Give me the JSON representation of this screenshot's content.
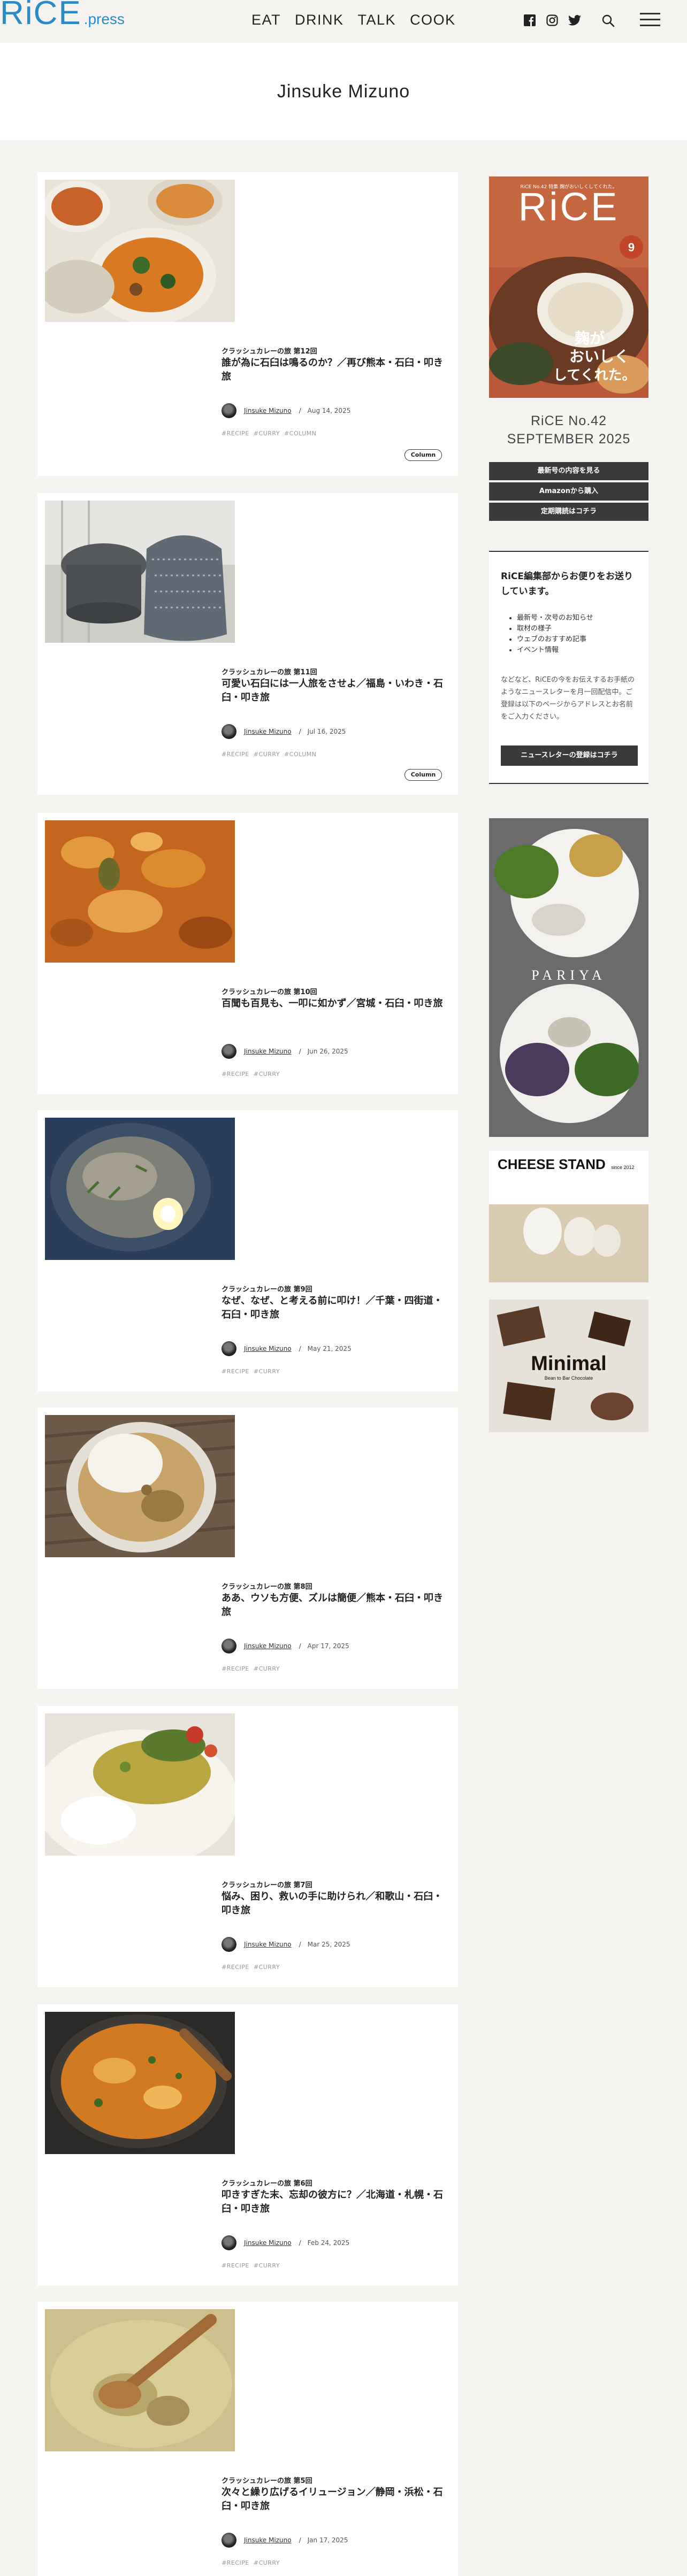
{
  "site": {
    "logo_main": "RiCE",
    "logo_sub": ".press"
  },
  "nav": [
    "EAT",
    "DRINK",
    "TALK",
    "COOK"
  ],
  "icons": {
    "social": [
      "facebook-icon",
      "instagram-icon",
      "twitter-icon"
    ],
    "search": "search-icon",
    "menu": "hamburger-menu-icon"
  },
  "page": {
    "title": "Jinsuke Mizuno"
  },
  "posts": [
    {
      "series": "クラッシュカレーの旅 第12回",
      "title": "誰が為に石臼は鳴るのか？／再び熊本・石臼・叩き旅",
      "author": "Jinsuke Mizuno",
      "date": "Aug 14, 2025",
      "tags": [
        "#RECIPE",
        "#CURRY",
        "#COLUMN"
      ],
      "badge": "Column"
    },
    {
      "series": "クラッシュカレーの旅 第11回",
      "title": "可愛い石臼には一人旅をさせよ／福島・いわき・石臼・叩き旅",
      "author": "Jinsuke Mizuno",
      "date": "Jul 16, 2025",
      "tags": [
        "#RECIPE",
        "#CURRY",
        "#COLUMN"
      ],
      "badge": "Column"
    },
    {
      "series": "クラッシュカレーの旅 第10回",
      "title": "百聞も百見も、一叩に如かず／宮城・石臼・叩き旅",
      "author": "Jinsuke Mizuno",
      "date": "Jun 26, 2025",
      "tags": [
        "#RECIPE",
        "#CURRY"
      ]
    },
    {
      "series": "クラッシュカレーの旅 第9回",
      "title": "なぜ、なぜ、と考える前に叩け！／千葉・四街道・石臼・叩き旅",
      "author": "Jinsuke Mizuno",
      "date": "May 21, 2025",
      "tags": [
        "#RECIPE",
        "#CURRY"
      ]
    },
    {
      "series": "クラッシュカレーの旅 第8回",
      "title": "ああ、ウソも方便、ズルは簡便／熊本・石臼・叩き旅",
      "author": "Jinsuke Mizuno",
      "date": "Apr 17, 2025",
      "tags": [
        "#RECIPE",
        "#CURRY"
      ]
    },
    {
      "series": "クラッシュカレーの旅 第7回",
      "title": "悩み、困り、救いの手に助けられ／和歌山・石臼・叩き旅",
      "author": "Jinsuke Mizuno",
      "date": "Mar 25, 2025",
      "tags": [
        "#RECIPE",
        "#CURRY"
      ]
    },
    {
      "series": "クラッシュカレーの旅 第6回",
      "title": "叩きすぎた末、忘却の彼方に？／北海道・札幌・石臼・叩き旅",
      "author": "Jinsuke Mizuno",
      "date": "Feb 24, 2025",
      "tags": [
        "#RECIPE",
        "#CURRY"
      ]
    },
    {
      "series": "クラッシュカレーの旅 第5回",
      "title": "次々と繰り広げるイリュージョン／静岡・浜松・石臼・叩き旅",
      "author": "Jinsuke Mizuno",
      "date": "Jan 17, 2025",
      "tags": [
        "#RECIPE",
        "#CURRY"
      ]
    }
  ],
  "sidebar": {
    "magazine": {
      "cover_logo": "RiCE",
      "cover_issue": "9",
      "cover_top": "RiCE No.42 特集 麹がおいしくしてくれた。",
      "cover_headline": [
        "麹が",
        "おいしく",
        "してくれた。"
      ],
      "caption_line1": "RiCE No.42",
      "caption_line2": "SEPTEMBER 2025"
    },
    "buttons": [
      "最新号の内容を見る",
      "Amazonから購入",
      "定期購読はコチラ"
    ],
    "newsletter": {
      "title": "RiCE編集部からお便りをお送りしています。",
      "items": [
        "最新号・次号のお知らせ",
        "取材の様子",
        "ウェブのおすすめ記事",
        "イベント情報"
      ],
      "body": "などなど、RiCEの今をお伝えするお手紙のようなニュースレターを月一回配信中。ご登録は以下のページからアドレスとお名前をご入力ください。",
      "button": "ニュースレターの登録はコチラ"
    },
    "ads": [
      {
        "brand": "PARIYA"
      },
      {
        "brand": "CHEESE STAND",
        "since": "since 2012"
      },
      {
        "brand": "Minimal",
        "sub": "Bean to Bar Chocolate"
      }
    ]
  }
}
